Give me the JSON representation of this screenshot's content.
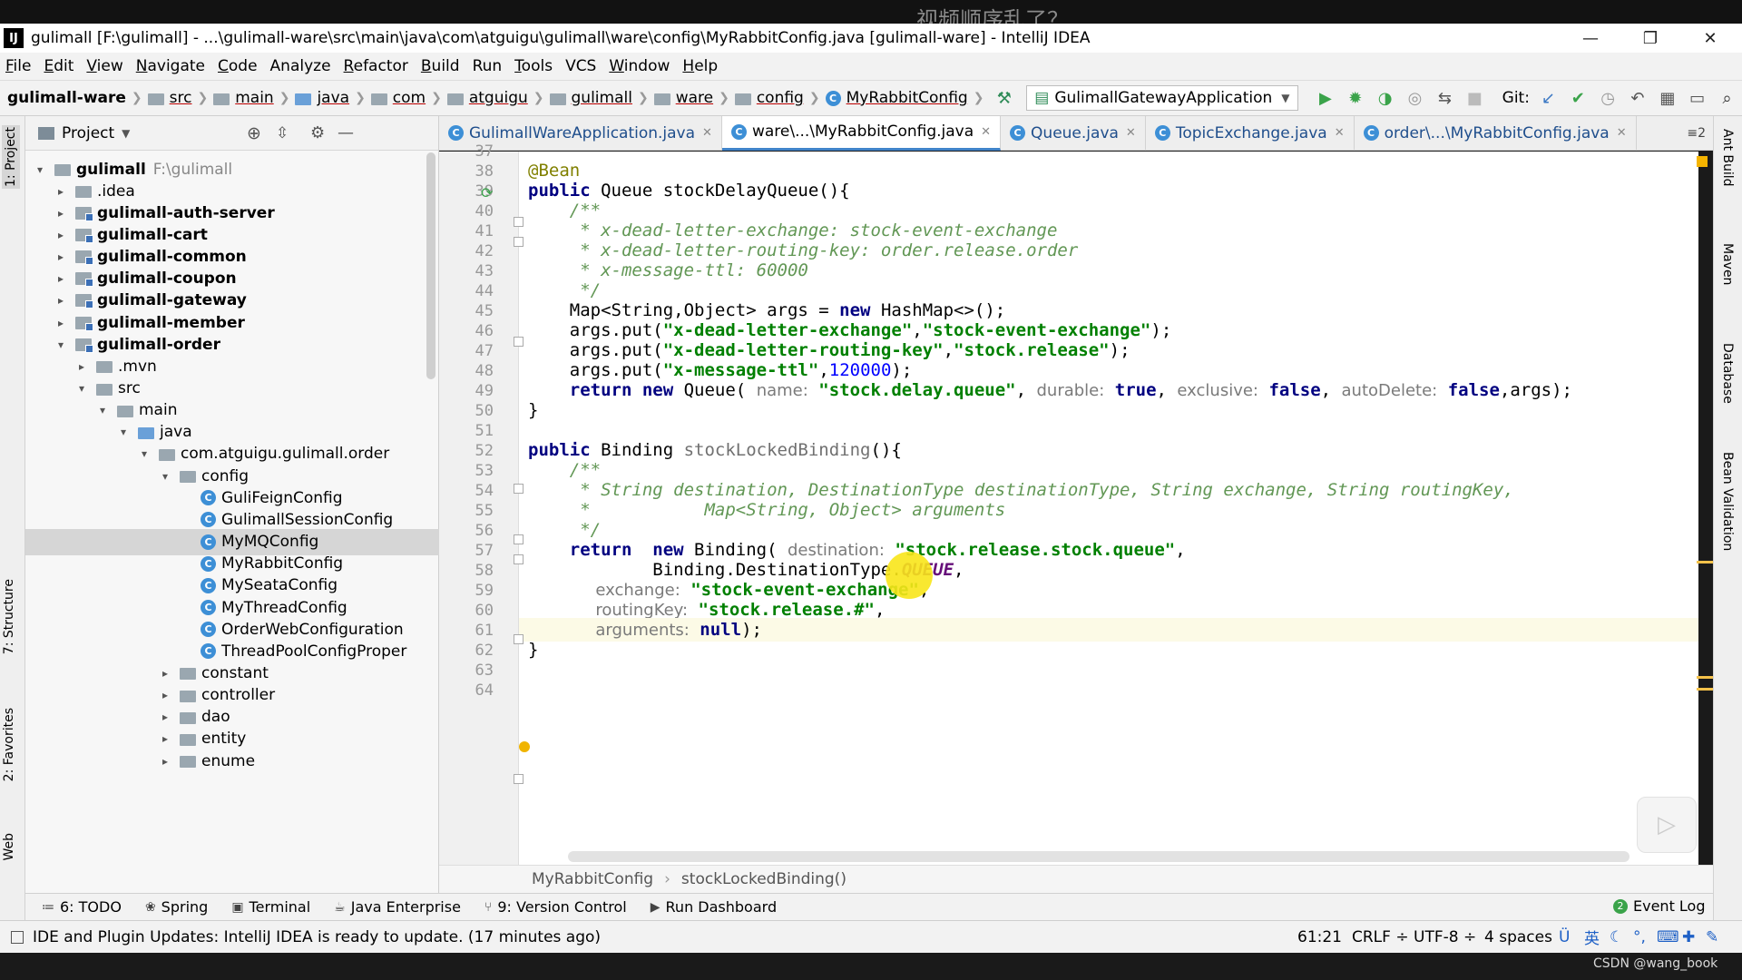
{
  "overlay_text": "视频顺序乱了？",
  "window": {
    "logo": "IJ",
    "title": "gulimall [F:\\gulimall] - ...\\gulimall-ware\\src\\main\\java\\com\\atguigu\\gulimall\\ware\\config\\MyRabbitConfig.java [gulimall-ware] - IntelliJ IDEA",
    "minimize": "—",
    "restore": "❐",
    "close": "✕"
  },
  "menu": [
    {
      "u": "F",
      "rest": "ile"
    },
    {
      "u": "E",
      "rest": "dit"
    },
    {
      "u": "V",
      "rest": "iew"
    },
    {
      "u": "N",
      "rest": "avigate"
    },
    {
      "u": "C",
      "rest": "ode"
    },
    {
      "u": "",
      "rest": "Analyze"
    },
    {
      "u": "R",
      "rest": "efactor"
    },
    {
      "u": "B",
      "rest": "uild"
    },
    {
      "u": "",
      "rest": "Run"
    },
    {
      "u": "T",
      "rest": "ools"
    },
    {
      "u": "",
      "rest": "VCS"
    },
    {
      "u": "W",
      "rest": "indow"
    },
    {
      "u": "H",
      "rest": "elp"
    }
  ],
  "breadcrumbs": [
    "gulimall-ware",
    "src",
    "main",
    "java",
    "com",
    "atguigu",
    "gulimall",
    "ware",
    "config",
    "MyRabbitConfig"
  ],
  "run_config": "GulimallGatewayApplication",
  "git_label": "Git:",
  "project_panel": {
    "title": "Project",
    "tree": [
      {
        "label": "gulimall",
        "path": "F:\\gulimall",
        "level": 0,
        "arrow": "▾",
        "bold": true,
        "icon": "folder"
      },
      {
        "label": ".idea",
        "level": 1,
        "arrow": "▸",
        "icon": "folder"
      },
      {
        "label": "gulimall-auth-server",
        "level": 1,
        "arrow": "▸",
        "bold": true,
        "icon": "module"
      },
      {
        "label": "gulimall-cart",
        "level": 1,
        "arrow": "▸",
        "bold": true,
        "icon": "module"
      },
      {
        "label": "gulimall-common",
        "level": 1,
        "arrow": "▸",
        "bold": true,
        "icon": "module"
      },
      {
        "label": "gulimall-coupon",
        "level": 1,
        "arrow": "▸",
        "bold": true,
        "icon": "module"
      },
      {
        "label": "gulimall-gateway",
        "level": 1,
        "arrow": "▸",
        "bold": true,
        "icon": "module"
      },
      {
        "label": "gulimall-member",
        "level": 1,
        "arrow": "▸",
        "bold": true,
        "icon": "module"
      },
      {
        "label": "gulimall-order",
        "level": 1,
        "arrow": "▾",
        "bold": true,
        "icon": "module"
      },
      {
        "label": ".mvn",
        "level": 2,
        "arrow": "▸",
        "icon": "folder"
      },
      {
        "label": "src",
        "level": 2,
        "arrow": "▾",
        "icon": "folder"
      },
      {
        "label": "main",
        "level": 3,
        "arrow": "▾",
        "icon": "folder"
      },
      {
        "label": "java",
        "level": 4,
        "arrow": "▾",
        "icon": "folder-blue"
      },
      {
        "label": "com.atguigu.gulimall.order",
        "level": 5,
        "arrow": "▾",
        "icon": "folder"
      },
      {
        "label": "config",
        "level": 6,
        "arrow": "▾",
        "icon": "folder"
      },
      {
        "label": "GuliFeignConfig",
        "level": 7,
        "arrow": "",
        "icon": "class"
      },
      {
        "label": "GulimallSessionConfig",
        "level": 7,
        "arrow": "",
        "icon": "class"
      },
      {
        "label": "MyMQConfig",
        "level": 7,
        "arrow": "",
        "icon": "class",
        "selected": true
      },
      {
        "label": "MyRabbitConfig",
        "level": 7,
        "arrow": "",
        "icon": "class"
      },
      {
        "label": "MySeataConfig",
        "level": 7,
        "arrow": "",
        "icon": "class"
      },
      {
        "label": "MyThreadConfig",
        "level": 7,
        "arrow": "",
        "icon": "class"
      },
      {
        "label": "OrderWebConfiguration",
        "level": 7,
        "arrow": "",
        "icon": "class"
      },
      {
        "label": "ThreadPoolConfigProper",
        "level": 7,
        "arrow": "",
        "icon": "class"
      },
      {
        "label": "constant",
        "level": 6,
        "arrow": "▸",
        "icon": "folder"
      },
      {
        "label": "controller",
        "level": 6,
        "arrow": "▸",
        "icon": "folder"
      },
      {
        "label": "dao",
        "level": 6,
        "arrow": "▸",
        "icon": "folder"
      },
      {
        "label": "entity",
        "level": 6,
        "arrow": "▸",
        "icon": "folder"
      },
      {
        "label": "enume",
        "level": 6,
        "arrow": "▸",
        "icon": "folder"
      }
    ]
  },
  "editor_tabs": [
    {
      "label": "GulimallWareApplication.java",
      "active": false
    },
    {
      "label": "ware\\...\\MyRabbitConfig.java",
      "active": true
    },
    {
      "label": "Queue.java",
      "active": false
    },
    {
      "label": "TopicExchange.java",
      "active": false
    },
    {
      "label": "order\\...\\MyRabbitConfig.java",
      "active": false
    }
  ],
  "tabs_overflow": "≡2",
  "line_numbers": [
    "37",
    "38",
    "39",
    "40",
    "41",
    "42",
    "43",
    "44",
    "45",
    "46",
    "47",
    "48",
    "49",
    "50",
    "51",
    "52",
    "53",
    "54",
    "55",
    "56",
    "57",
    "58",
    "59",
    "60",
    "61",
    "62",
    "63",
    "64"
  ],
  "code": {
    "l38": "@Bean",
    "l39_kw": "public",
    "l39_rest": " Queue stockDelayQueue(){",
    "l40": "    /**",
    "l41": "     * x-dead-letter-exchange: stock-event-exchange",
    "l42": "     * x-dead-letter-routing-key: order.release.order",
    "l43": "     * x-message-ttl: 60000",
    "l44": "     */",
    "l45_a": "    Map<String,Object> args = ",
    "l45_kw": "new",
    "l45_b": " HashMap<>();",
    "l46_a": "    args.put(",
    "l46_s1": "\"x-dead-letter-exchange\"",
    "l46_c": ",",
    "l46_s2": "\"stock-event-exchange\"",
    "l46_e": ");",
    "l47_a": "    args.put(",
    "l47_s1": "\"x-dead-letter-routing-key\"",
    "l47_c": ",",
    "l47_s2": "\"stock.release\"",
    "l47_e": ");",
    "l48_a": "    args.put(",
    "l48_s1": "\"x-message-ttl\"",
    "l48_c": ",",
    "l48_n": "120000",
    "l48_e": ");",
    "l49_kw1": "    return",
    "l49_sp": " ",
    "l49_kw2": "new",
    "l49_a": " Queue( ",
    "l49_h1": "name:",
    "l49_s1": " \"stock.delay.queue\"",
    "l49_c1": ", ",
    "l49_h2": "durable:",
    "l49_t": " true",
    "l49_c2": ", ",
    "l49_h3": "exclusive:",
    "l49_f1": " false",
    "l49_c3": ", ",
    "l49_h4": "autoDelete:",
    "l49_f2": " false",
    "l49_e": ",args);",
    "l50": "}",
    "l52_kw": "public",
    "l52_a": " Binding ",
    "l52_fn": "stockLockedBinding",
    "l52_e": "(){",
    "l53": "    /**",
    "l54": "     * String destination, DestinationType destinationType, String exchange, String routingKey,",
    "l55": "     *           Map<String, Object> arguments",
    "l56": "     */",
    "l57_kw1": "    return",
    "l57_sp": "  ",
    "l57_kw2": "new",
    "l57_a": " Binding( ",
    "l57_h": "destination:",
    "l57_s": " \"stock.release.stock.queue\"",
    "l57_e": ",",
    "l58_a": "            Binding.DestinationType.",
    "l58_it": "QUEUE",
    "l58_e": ",",
    "l59_h": "             exchange:",
    "l59_s": " \"stock-event-exchange\"",
    "l59_e": ",",
    "l60_h": "             routingKey:",
    "l60_s": " \"stock.release.#\"",
    "l60_e": ",",
    "l61_h": "             arguments:",
    "l61_kw": " null",
    "l61_e": ");",
    "l62": "}"
  },
  "editor_breadcrumb": [
    "MyRabbitConfig",
    "stockLockedBinding()"
  ],
  "left_tabs": [
    "1: Project",
    "7: Structure",
    "2: Favorites",
    "Web"
  ],
  "right_tabs": [
    "Ant Build",
    "Maven",
    "Database",
    "Bean Validation"
  ],
  "bottom_tools": [
    {
      "icon": "≔",
      "label": "6: TODO"
    },
    {
      "icon": "❀",
      "label": "Spring"
    },
    {
      "icon": "▣",
      "label": "Terminal"
    },
    {
      "icon": "☕",
      "label": "Java Enterprise"
    },
    {
      "icon": "⑂",
      "label": "9: Version Control"
    },
    {
      "icon": "▶",
      "label": "Run Dashboard"
    }
  ],
  "event_log": "Event Log",
  "status": {
    "message": "IDE and Plugin Updates: IntelliJ IDEA is ready to update. (17 minutes ago)",
    "position": "61:21",
    "line_sep": "CRLF ÷",
    "encoding": "UTF-8 ÷",
    "indent": "4 spaces",
    "ime": "英"
  },
  "watermark": "CSDN @wang_book"
}
